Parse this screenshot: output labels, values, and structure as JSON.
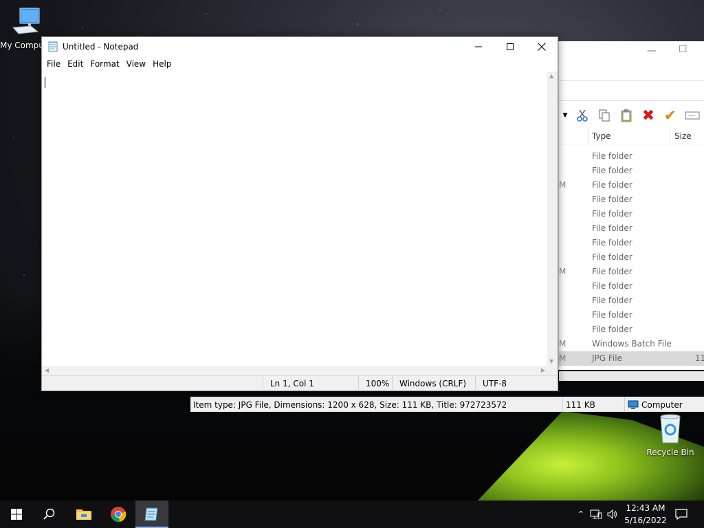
{
  "desktop": {
    "icons": [
      {
        "label": "My Computer"
      },
      {
        "label": "Recycle Bin"
      }
    ]
  },
  "notepad": {
    "title": "Untitled - Notepad",
    "menu": [
      "File",
      "Edit",
      "Format",
      "View",
      "Help"
    ],
    "content": "",
    "status": {
      "position": "Ln 1, Col 1",
      "zoom": "100%",
      "line_ending": "Windows (CRLF)",
      "encoding": "UTF-8"
    }
  },
  "explorer": {
    "columns": {
      "type": "Type",
      "size": "Size"
    },
    "rows": [
      {
        "frag": "",
        "type": "File folder",
        "size": ""
      },
      {
        "frag": "",
        "type": "File folder",
        "size": ""
      },
      {
        "frag": "M",
        "type": "File folder",
        "size": ""
      },
      {
        "frag": "",
        "type": "File folder",
        "size": ""
      },
      {
        "frag": "",
        "type": "File folder",
        "size": ""
      },
      {
        "frag": "",
        "type": "File folder",
        "size": ""
      },
      {
        "frag": "",
        "type": "File folder",
        "size": ""
      },
      {
        "frag": "",
        "type": "File folder",
        "size": ""
      },
      {
        "frag": "M",
        "type": "File folder",
        "size": ""
      },
      {
        "frag": "",
        "type": "File folder",
        "size": ""
      },
      {
        "frag": "",
        "type": "File folder",
        "size": ""
      },
      {
        "frag": "",
        "type": "File folder",
        "size": ""
      },
      {
        "frag": "",
        "type": "File folder",
        "size": ""
      },
      {
        "frag": "M",
        "type": "Windows Batch File",
        "size": ""
      },
      {
        "frag": "M",
        "type": "JPG File",
        "size": "11"
      }
    ],
    "status": {
      "info": "Item type: JPG File, Dimensions: 1200 x 628, Size: 111 KB, Title: 972723572",
      "size": "111 KB",
      "location": "Computer"
    }
  },
  "taskbar": {
    "time": "12:43 AM",
    "date": "5/16/2022"
  },
  "colors": {
    "accent": "#0078d7",
    "delete_red": "#d61a1a",
    "check_orange": "#e8801a"
  }
}
